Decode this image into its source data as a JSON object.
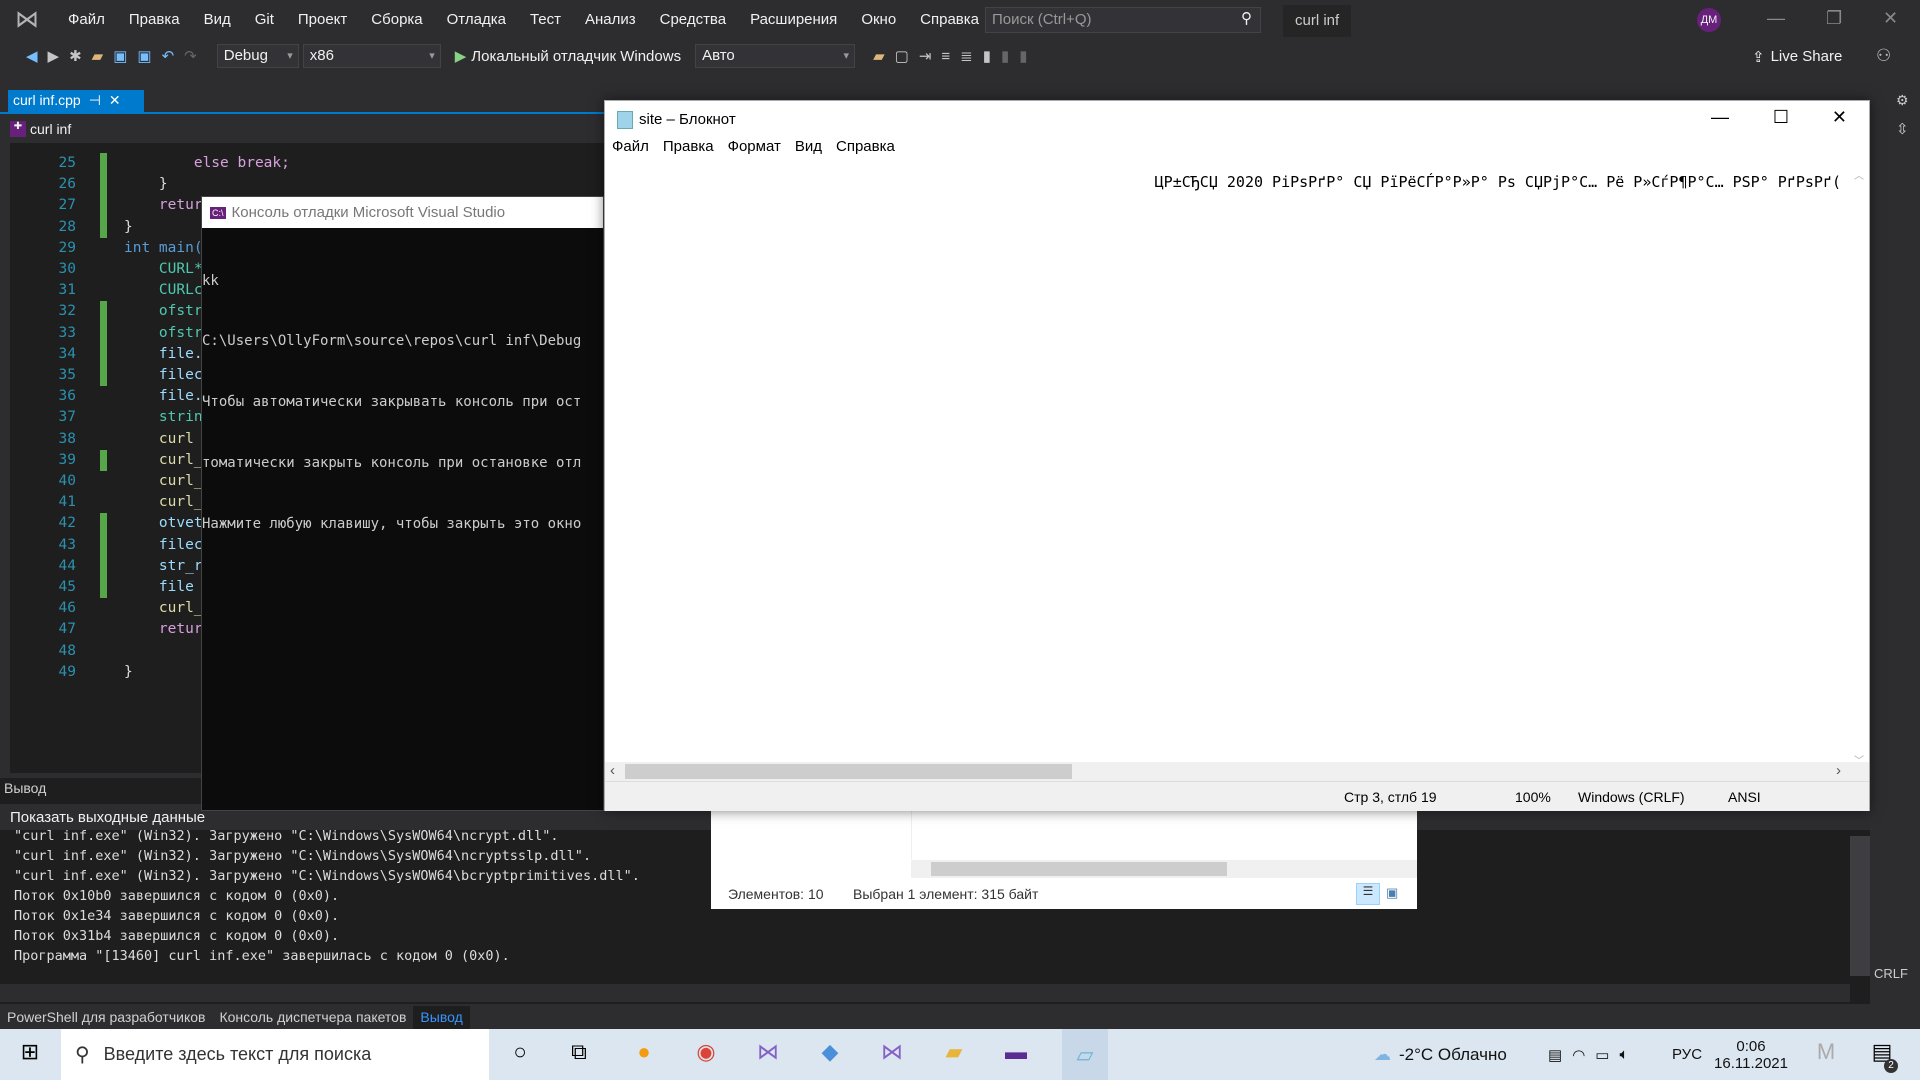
{
  "vs": {
    "menu": [
      "Файл",
      "Правка",
      "Вид",
      "Git",
      "Проект",
      "Сборка",
      "Отладка",
      "Тест",
      "Анализ",
      "Средства",
      "Расширения",
      "Окно",
      "Справка"
    ],
    "search_placeholder": "Поиск (Ctrl+Q)",
    "solution_name": "curl inf",
    "avatar_initials": "ДМ",
    "toolbar": {
      "config": "Debug",
      "platform": "x86",
      "run_label": "Локальный отладчик Windows",
      "auto": "Авто",
      "live_share": "Live Share"
    },
    "tab": {
      "label": "curl inf.cpp"
    },
    "nav_project": "curl inf",
    "editor": {
      "line_numbers": [
        "25",
        "26",
        "27",
        "28",
        "29",
        "30",
        "31",
        "32",
        "33",
        "34",
        "35",
        "36",
        "37",
        "38",
        "39",
        "40",
        "41",
        "42",
        "43",
        "44",
        "45",
        "46",
        "47",
        "48",
        "49"
      ],
      "lines": [
        "        else break;",
        "    }",
        "    return (site);",
        "}",
        "int main(",
        "    CURL*",
        "    CURLc",
        "    ofstr",
        "    ofstr",
        "    file.",
        "    filec",
        "    file.",
        "    strin",
        "    curl ",
        "    curl_",
        "    curl_",
        "    curl_",
        "    otvet",
        "    filec",
        "    str_r",
        "    file ",
        "    curl_",
        "    retur",
        "",
        "}"
      ]
    },
    "output": {
      "title": "Вывод",
      "show_label": "Показать выходные данные",
      "lines": [
        "\"curl inf.exe\" (Win32). Загружено \"C:\\Windows\\SysWOW64\\ncrypt.dll\".",
        "\"curl inf.exe\" (Win32). Загружено \"C:\\Windows\\SysWOW64\\ncryptsslp.dll\".",
        "\"curl inf.exe\" (Win32). Загружено \"C:\\Windows\\SysWOW64\\bcryptprimitives.dll\".",
        "Поток 0x10b0 завершился с кодом 0 (0x0).",
        "Поток 0x1e34 завершился с кодом 0 (0x0).",
        "Поток 0x31b4 завершился с кодом 0 (0x0).",
        "Программа \"[13460] curl inf.exe\" завершилась с кодом 0 (0x0)."
      ]
    },
    "bottom_tabs": [
      "PowerShell для разработчиков",
      "Консоль диспетчера пакетов",
      "Вывод"
    ],
    "crlf": "CRLF"
  },
  "console": {
    "title": "Консоль отладки Microsoft Visual Studio",
    "lines": [
      "kk",
      "C:\\Users\\OllyForm\\source\\repos\\curl inf\\Debug",
      "Чтобы автоматически закрывать консоль при ост",
      "томатически закрыть консоль при остановке отл",
      "Нажмите любую клавишу, чтобы закрыть это окно"
    ]
  },
  "notepad": {
    "title": "site – Блокнот",
    "menu": [
      "Файл",
      "Правка",
      "Формат",
      "Вид",
      "Справка"
    ],
    "text": "ЦР±СЂСЏ 2020 РіРѕРґР° СЏ РїРёСЃР°Р»Р° Рѕ СЏРјР°С… Рё Р»СѓР¶Р°С… РЅР° РґРѕРґ(",
    "status": {
      "position": "Стр 3, стлб 19",
      "zoom": "100%",
      "eol": "Windows (CRLF)",
      "encoding": "ANSI"
    }
  },
  "explorer": {
    "items": "Элементов: 10",
    "selected": "Выбран 1 элемент: 315 байт"
  },
  "taskbar": {
    "search_placeholder": "Введите здесь текст для поиска",
    "weather": "-2°C  Облачно",
    "lang": "РУС",
    "time": "0:06",
    "date": "16.11.2021",
    "notif_count": "2"
  }
}
